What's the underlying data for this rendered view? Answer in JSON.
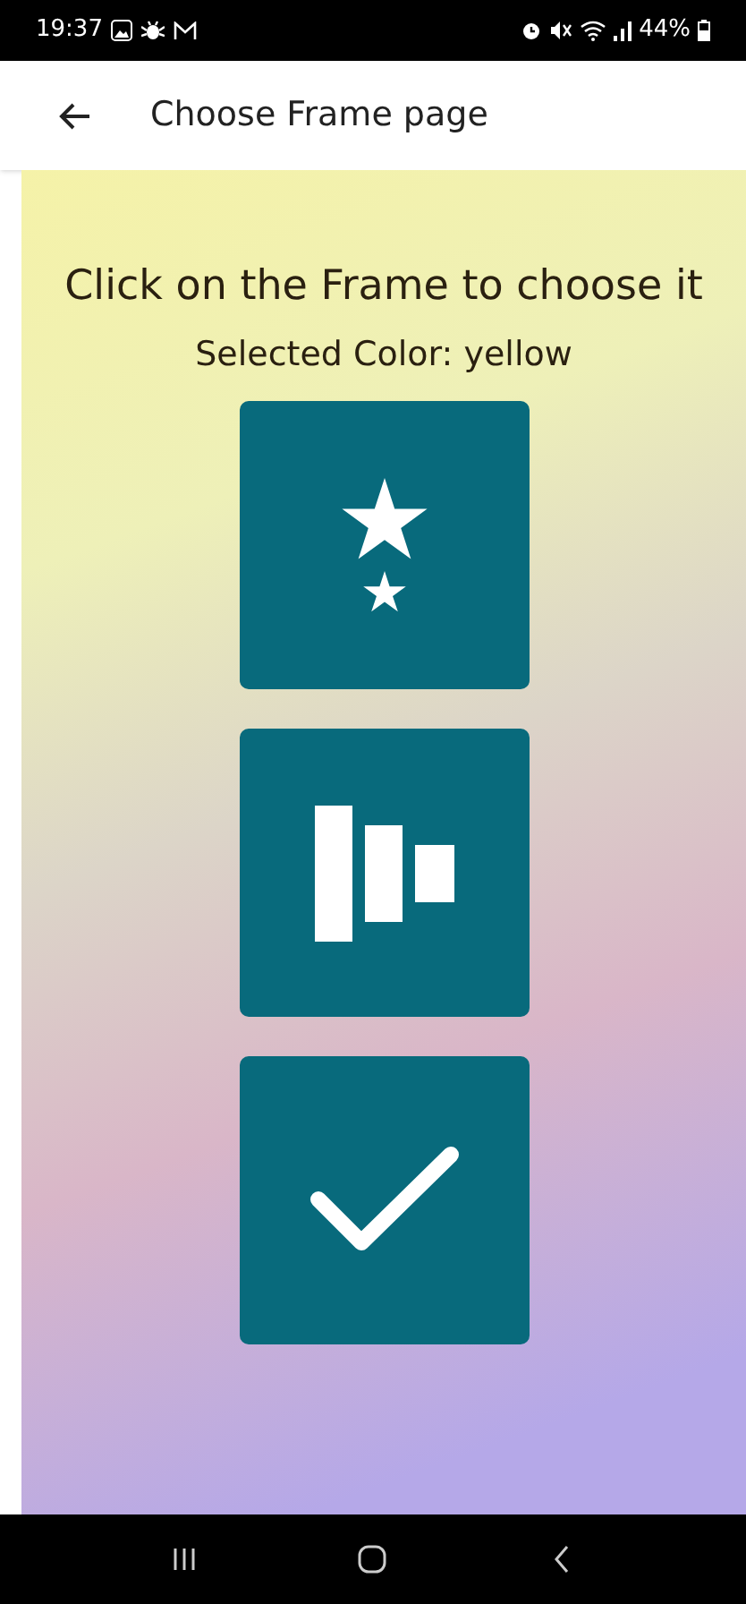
{
  "status_bar": {
    "time": "19:37",
    "battery": "44%"
  },
  "app_bar": {
    "title": "Choose Frame page"
  },
  "heading": "Click on the Frame to choose it",
  "subheading": "Selected Color: yellow",
  "frames": [
    {
      "kind": "stars"
    },
    {
      "kind": "bars"
    },
    {
      "kind": "check"
    }
  ]
}
